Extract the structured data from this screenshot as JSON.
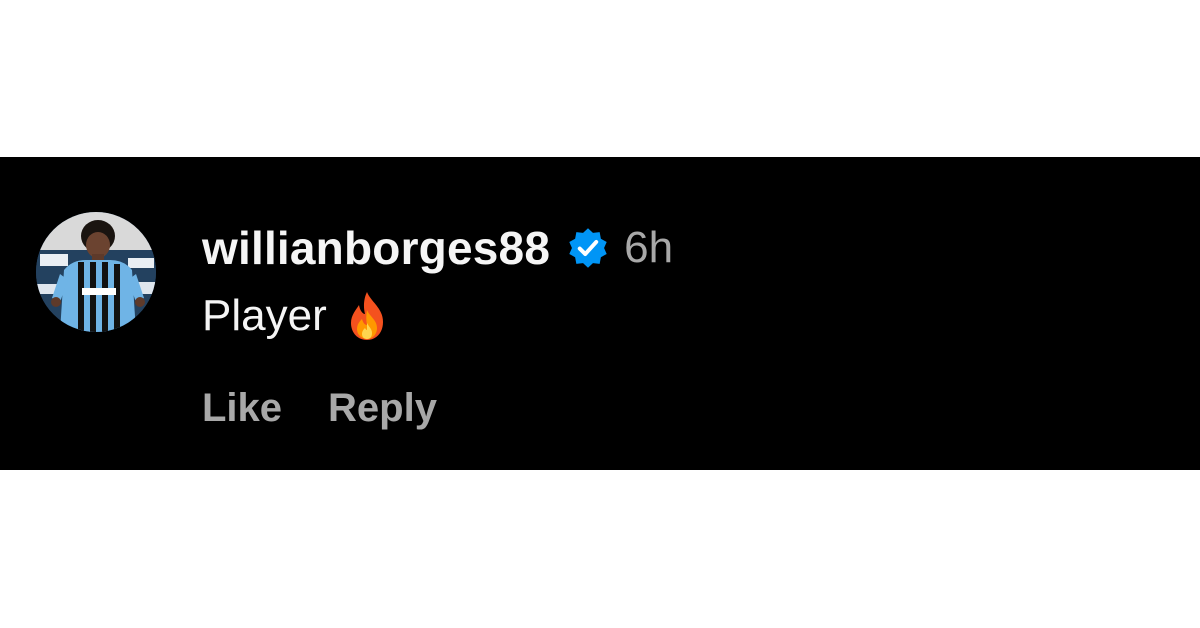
{
  "comment": {
    "username": "willianborges88",
    "verified_icon": "verified-badge-icon",
    "timestamp": "6h",
    "text": "Player",
    "emoji_icon": "fire-emoji-icon",
    "actions": {
      "like_label": "Like",
      "reply_label": "Reply"
    }
  },
  "colors": {
    "background": "#000000",
    "primary_text": "#f5f5f5",
    "secondary_text": "#a8a8a8",
    "verified_blue": "#0095f6"
  }
}
